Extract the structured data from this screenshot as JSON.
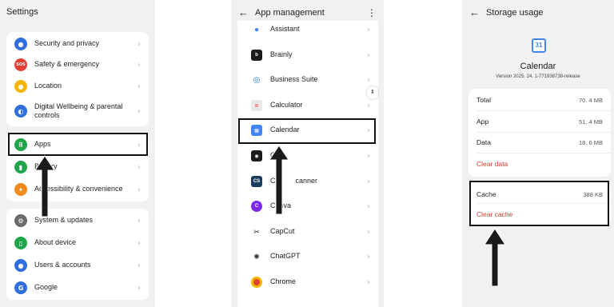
{
  "settings": {
    "title": "Settings",
    "group1": [
      {
        "label": "Security and privacy",
        "icon": "shield-icon",
        "color": "#2f6fe0"
      },
      {
        "label": "Safety & emergency",
        "icon": "sos-icon",
        "color": "#e64032",
        "glyph": "SOS"
      },
      {
        "label": "Location",
        "icon": "location-pin-icon",
        "color": "#f4b400"
      },
      {
        "label": "Digital Wellbeing & parental controls",
        "icon": "wellbeing-icon",
        "color": "#2f6fe0"
      }
    ],
    "group2": [
      {
        "label": "Apps",
        "icon": "apps-grid-icon",
        "color": "#1fa64a"
      },
      {
        "label": "Battery",
        "icon": "battery-icon",
        "color": "#1fa64a"
      },
      {
        "label": "Accessibility & convenience",
        "icon": "accessibility-icon",
        "color": "#f08a1c"
      }
    ],
    "group3": [
      {
        "label": "System & updates",
        "icon": "gear-icon",
        "color": "#6b6b6b"
      },
      {
        "label": "About device",
        "icon": "phone-icon",
        "color": "#1fa64a"
      },
      {
        "label": "Users & accounts",
        "icon": "user-icon",
        "color": "#2f6fe0"
      },
      {
        "label": "Google",
        "icon": "google-icon",
        "color": "#2f6fe0",
        "glyph": "G"
      }
    ]
  },
  "app_management": {
    "title": "App management",
    "back_glyph": "←",
    "menu_glyph": "⋮",
    "apps": [
      {
        "label": "Assistant",
        "icon": "assistant-icon",
        "color": "#4285f4"
      },
      {
        "label": "Brainly",
        "icon": "brainly-icon",
        "color": "#1b1b1b"
      },
      {
        "label": "Business Suite",
        "icon": "business-suite-icon",
        "color": "#1877f2"
      },
      {
        "label": "Calculator",
        "icon": "calculator-icon",
        "color": "#e9e9e9"
      },
      {
        "label": "Calendar",
        "icon": "calendar-icon",
        "color": "#4285f4"
      },
      {
        "label": "C",
        "icon": "app-icon",
        "color": "#1b1b1b"
      },
      {
        "label": "Ca        canner",
        "icon": "camscanner-icon",
        "color": "#1a3d5d",
        "glyph": "CS"
      },
      {
        "label": "Canva",
        "icon": "canva-icon",
        "color": "#7d2ae8"
      },
      {
        "label": "CapCut",
        "icon": "capcut-icon",
        "color": "#ffffff"
      },
      {
        "label": "ChatGPT",
        "icon": "chatgpt-icon",
        "color": "#ffffff"
      },
      {
        "label": "Chrome",
        "icon": "chrome-icon",
        "color": "#db4437"
      }
    ]
  },
  "storage": {
    "title": "Storage usage",
    "back_glyph": "←",
    "app_name": "Calendar",
    "version": "Version 2025. 24. 1-771938738-release",
    "rows": [
      {
        "label": "Total",
        "value": "70. 4 MB"
      },
      {
        "label": "App",
        "value": "51. 4 MB"
      },
      {
        "label": "Data",
        "value": "18. 6 MB"
      }
    ],
    "clear_data": "Clear data",
    "cache_label": "Cache",
    "cache_value": "388 KB",
    "clear_cache": "Clear cache"
  },
  "chevron_glyph": "›",
  "colors": {
    "background": "#f1f1f3",
    "card": "#ffffff",
    "destructive": "#d83a2a",
    "highlight": "#111111"
  }
}
